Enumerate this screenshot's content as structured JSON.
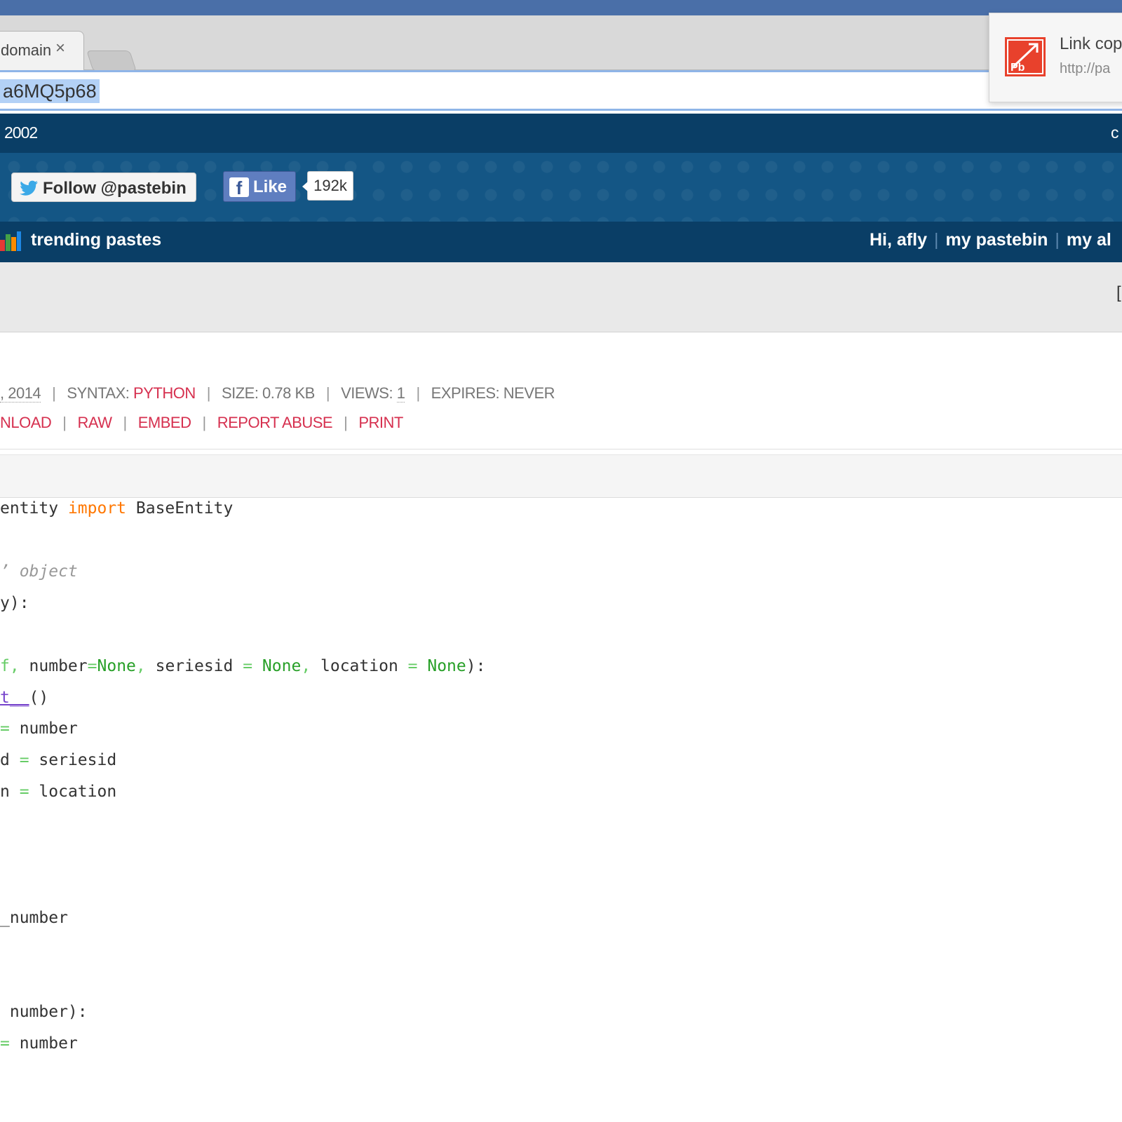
{
  "browser": {
    "tab_title": "domain",
    "tab_close": "×",
    "url": "a6MQ5p68"
  },
  "notification": {
    "logo_text": "Pb",
    "title": "Link cop",
    "url": "http://pa"
  },
  "header": {
    "year": "2002",
    "right_text": "c",
    "twitter_label": "Follow @pastebin",
    "like_label": "Like",
    "like_count": "192k",
    "trending_label": "trending pastes",
    "user_greeting": "Hi, afly",
    "my_pastebin": "my pastebin",
    "my_alerts": "my al",
    "grey_right": "["
  },
  "paste_info": {
    "date": ", 2014",
    "syntax_label": "SYNTAX:",
    "syntax_value": "PYTHON",
    "size": "SIZE: 0.78 KB",
    "views_label": "VIEWS:",
    "views_value": "1",
    "expires": "EXPIRES: NEVER"
  },
  "actions": {
    "download": "NLOAD",
    "raw": "RAW",
    "embed": "EMBED",
    "report": "REPORT ABUSE",
    "print": "PRINT"
  },
  "colors": {
    "nav_dark": "#0a3e66",
    "social_bar": "#145685",
    "accent_red": "#d6304f",
    "keyword_orange": "#ff7700",
    "none_green": "#28a028"
  }
}
